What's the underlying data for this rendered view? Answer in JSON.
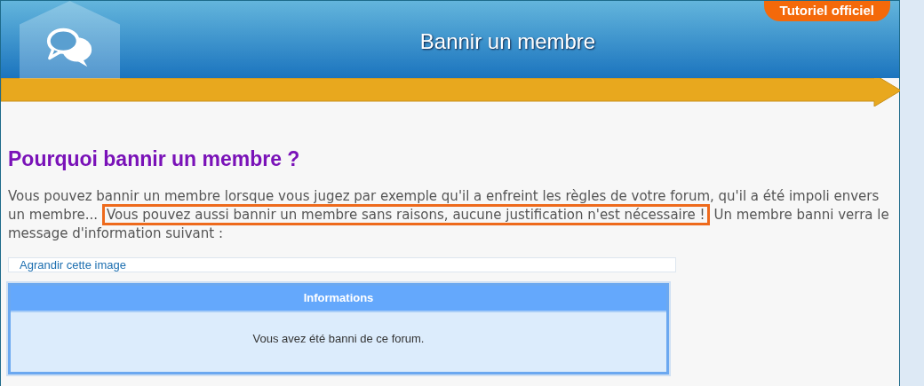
{
  "header": {
    "title": "Bannir un membre",
    "badge": "Tutoriel officiel"
  },
  "heading": "Pourquoi bannir un membre ?",
  "paragraph": [
    {
      "text": "Vous pouvez bannir un membre lorsque vous jugez par exemple qu'il a enfreint les règles de votre forum, qu'il a été impoli envers un membre... ",
      "highlighted": false
    },
    {
      "text": "Vous pouvez aussi bannir un membre sans raisons, aucune justification n'est nécessaire !",
      "highlighted": true
    },
    {
      "text": " Un membre banni verra le message d'information suivant :",
      "highlighted": false
    }
  ],
  "image_link": "Agrandir cette image",
  "info_box": {
    "title": "Informations",
    "message": "Vous avez été banni de ce forum."
  }
}
